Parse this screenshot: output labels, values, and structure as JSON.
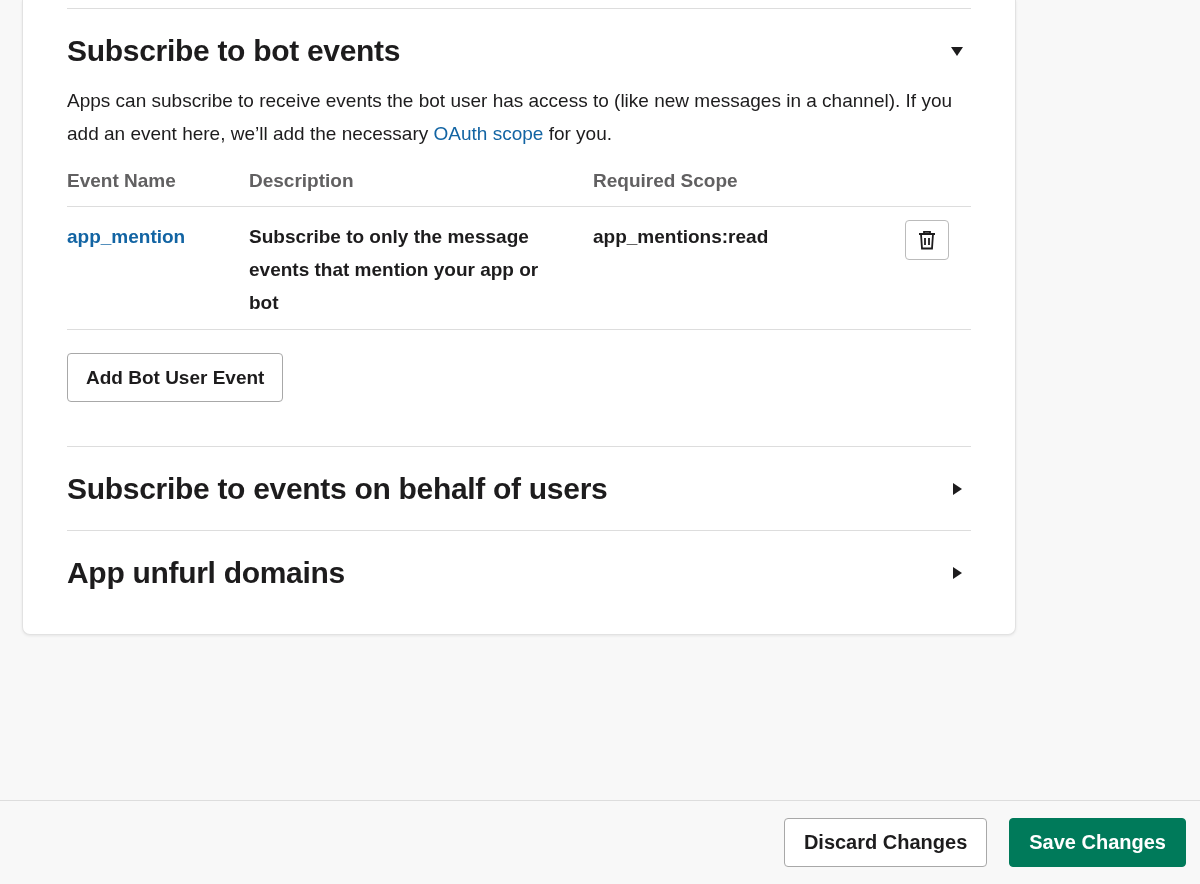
{
  "sections": [
    {
      "title": "Subscribe to bot events",
      "expanded": true,
      "description": {
        "before": "Apps can subscribe to receive events the bot user has access to (like new messages in a channel). If you add an event here, we’ll add the necessary ",
        "link": "OAuth scope",
        "after": " for you."
      },
      "table": {
        "columns": [
          "Event Name",
          "Description",
          "Required Scope"
        ],
        "rows": [
          {
            "event": "app_mention",
            "description": "Subscribe to only the message events that mention your app or bot",
            "scope": "app_mentions:read"
          }
        ]
      },
      "button": "Add Bot User Event"
    },
    {
      "title": "Subscribe to events on behalf of users",
      "expanded": false
    },
    {
      "title": "App unfurl domains",
      "expanded": false
    }
  ],
  "footer": {
    "buttons": [
      {
        "label": "Discard Changes",
        "kind": "secondary"
      },
      {
        "label": "Save Changes",
        "kind": "primary"
      }
    ]
  }
}
